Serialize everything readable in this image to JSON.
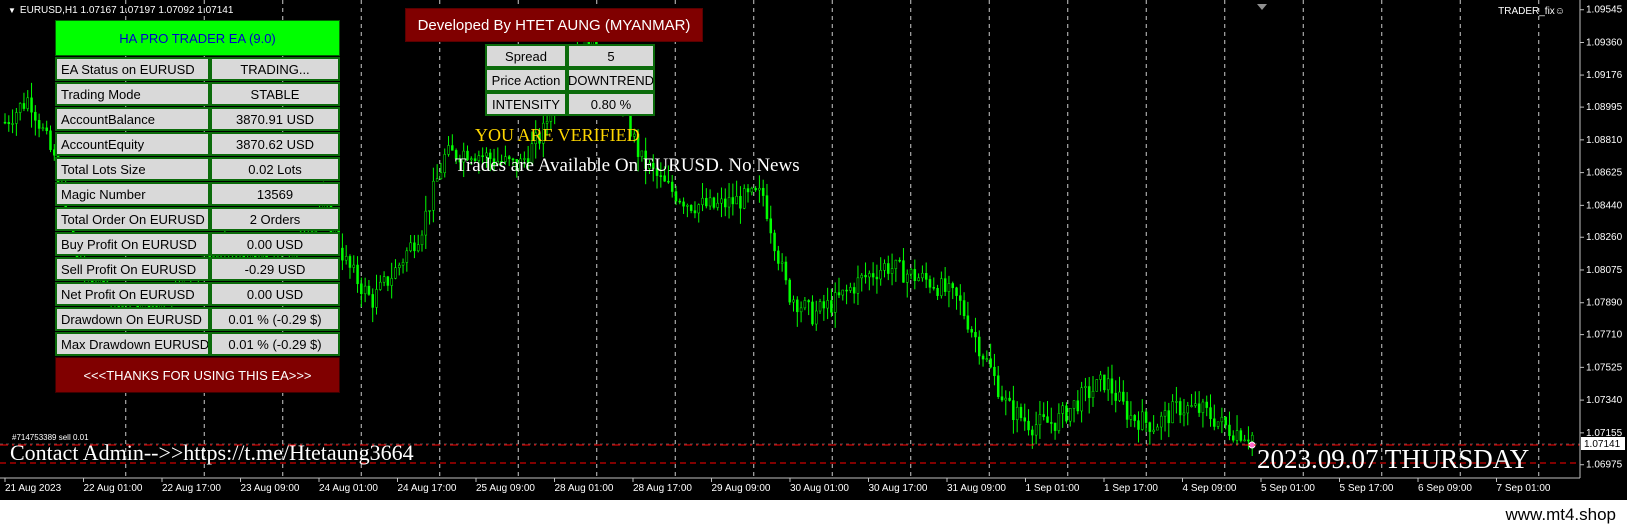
{
  "window": {
    "symbol_info": "EURUSD,H1  1.07167 1.07197 1.07092 1.07141",
    "trader_fix": "TRADER_fix☺"
  },
  "ea_panel": {
    "title": "HA PRO TRADER EA (9.0)",
    "rows": [
      {
        "label": "EA Status on EURUSD",
        "value": "TRADING..."
      },
      {
        "label": "Trading Mode",
        "value": "STABLE"
      },
      {
        "label": "AccountBalance",
        "value": "3870.91 USD"
      },
      {
        "label": "AccountEquity",
        "value": "3870.62 USD"
      },
      {
        "label": "Total Lots Size",
        "value": "0.02 Lots"
      },
      {
        "label": "Magic Number",
        "value": "13569"
      },
      {
        "label": "Total Order On EURUSD",
        "value": "2 Orders"
      },
      {
        "label": "Buy Profit On EURUSD",
        "value": "0.00 USD"
      },
      {
        "label": "Sell Profit On EURUSD",
        "value": "-0.29 USD"
      },
      {
        "label": "Net Profit On EURUSD",
        "value": "0.00 USD"
      },
      {
        "label": "Drawdown On EURUSD",
        "value": "0.01 % (-0.29 $)"
      },
      {
        "label": "Max Drawdown EURUSD",
        "value": "0.01 % (-0.29 $)"
      }
    ],
    "thanks": "<<<THANKS FOR USING THIS EA>>>"
  },
  "developer_banner": "Developed By HTET AUNG (MYANMAR)",
  "spread_table": [
    {
      "label": "Spread",
      "value": "5"
    },
    {
      "label": "Price Action",
      "value": "DOWNTREND"
    },
    {
      "label": "INTENSITY",
      "value": "0.80 %"
    }
  ],
  "verified_text": "YOU ARE VERIFIED",
  "trades_text": "Trades are Available On EURUSD. No News",
  "order_label": "#714753389 sell 0.01",
  "contact_text": "Contact Admin-->>https://t.me/Htetaung3664",
  "date_text": "2023.09.07 THURSDAY",
  "footer_text": "www.mt4.shop",
  "colors": {
    "candle": "#00ff00",
    "panel_green": "#00ff00",
    "panel_red": "#800000",
    "sell_line": "#ff0000"
  },
  "chart_data": {
    "type": "candlestick",
    "symbol": "EURUSD",
    "timeframe": "H1",
    "ylim": [
      1.069,
      1.096
    ],
    "y_ticks": [
      "1.09545",
      "1.09360",
      "1.09176",
      "1.08995",
      "1.08810",
      "1.08625",
      "1.08440",
      "1.08260",
      "1.08075",
      "1.07890",
      "1.07710",
      "1.07525",
      "1.07340",
      "1.07155",
      "1.06975"
    ],
    "current_price": "1.07141",
    "x_ticks": [
      "21 Aug 2023",
      "22 Aug 01:00",
      "22 Aug 17:00",
      "23 Aug 09:00",
      "24 Aug 01:00",
      "24 Aug 17:00",
      "25 Aug 09:00",
      "28 Aug 01:00",
      "28 Aug 17:00",
      "29 Aug 09:00",
      "30 Aug 01:00",
      "30 Aug 17:00",
      "31 Aug 09:00",
      "1 Sep 01:00",
      "1 Sep 17:00",
      "4 Sep 09:00",
      "5 Sep 01:00",
      "5 Sep 17:00",
      "6 Sep 09:00",
      "7 Sep 01:00"
    ],
    "price_path": [
      1.0891,
      1.0905,
      1.087,
      1.0808,
      1.0798,
      1.079,
      1.0782,
      1.08,
      1.0812,
      1.0818,
      1.0812,
      1.0808,
      1.0822,
      1.0845,
      1.081,
      1.079,
      1.0808,
      1.083,
      1.0872,
      1.0875,
      1.087,
      1.0866,
      1.0885,
      1.093,
      1.0935,
      1.091,
      1.087,
      1.0855,
      1.0845,
      1.0843,
      1.0847,
      1.085,
      1.0795,
      1.0782,
      1.079,
      1.0802,
      1.081,
      1.0805,
      1.08,
      1.079,
      1.076,
      1.073,
      1.072,
      1.0722,
      1.0735,
      1.0745,
      1.0725,
      1.072,
      1.073,
      1.0728,
      1.0718,
      1.0714
    ]
  }
}
